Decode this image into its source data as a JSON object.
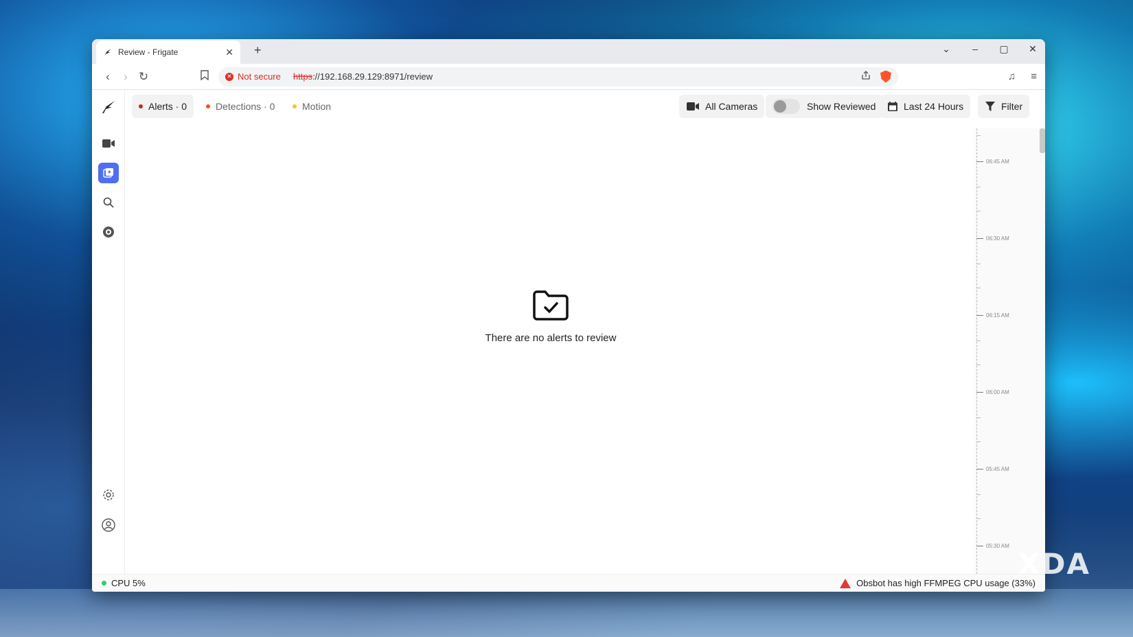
{
  "browser": {
    "tab_title": "Review - Frigate",
    "new_tab": "+",
    "close_tab": "✕",
    "address": {
      "security_label": "Not secure",
      "scheme": "https",
      "url_rest": "://192.168.29.129:8971/review"
    },
    "window_controls": [
      "⌄",
      "–",
      "▢",
      "✕"
    ]
  },
  "app": {
    "topbar": {
      "alerts": "Alerts · 0",
      "detections": "Detections · 0",
      "motion": "Motion",
      "all_cameras": "All Cameras",
      "show_reviewed": "Show Reviewed",
      "show_reviewed_on": false,
      "range": "Last 24 Hours",
      "filter": "Filter"
    },
    "empty_state": "There are no alerts to review",
    "timeline_labels": [
      "06:45 AM",
      "06:30 AM",
      "06:15 AM",
      "06:00 AM",
      "05:45 AM",
      "05:30 AM"
    ],
    "status": {
      "cpu": "CPU 5%",
      "warning": "Obsbot has high FFMPEG CPU usage (33%)"
    }
  },
  "colors": {
    "alert_dot": "#c62828",
    "detection_dot": "#f4511e",
    "motion_dot": "#fbc02d",
    "active_nav": "#4f6ff0",
    "cpu_ok": "#2ecc71",
    "warning": "#e53935"
  },
  "icons": [
    "frigate-logo-icon",
    "camera-icon",
    "review-icon",
    "search-icon",
    "explore-icon",
    "settings-icon",
    "account-icon",
    "calendar-icon",
    "filter-icon",
    "folder-check-icon"
  ],
  "watermark": "XDA"
}
